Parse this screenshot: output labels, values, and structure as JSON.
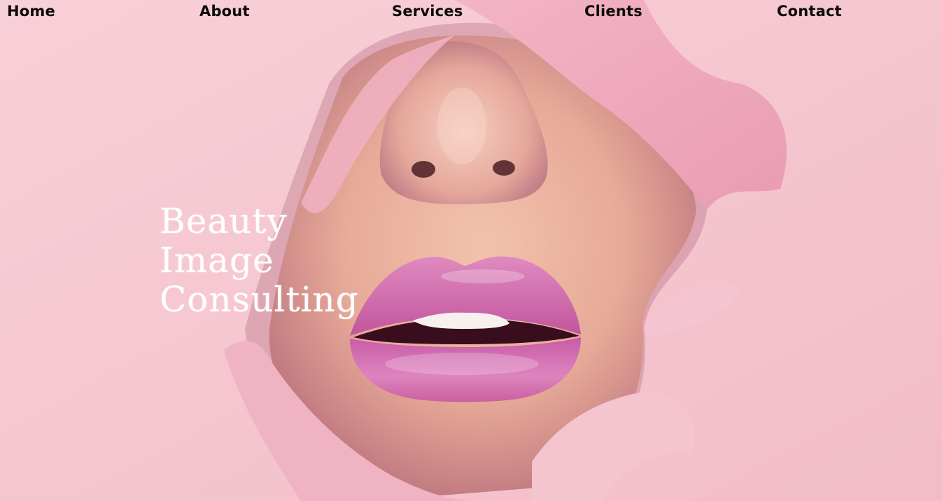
{
  "nav": {
    "items": [
      {
        "label": "Home"
      },
      {
        "label": "About"
      },
      {
        "label": "Services"
      },
      {
        "label": "Clients"
      },
      {
        "label": "Contact"
      }
    ]
  },
  "hero": {
    "title_lines": [
      "Beauty",
      "Image",
      "Consulting"
    ]
  },
  "colors": {
    "background": "#f6c8d0",
    "lip": "#d874b4",
    "nav_text": "#0a0a0a",
    "title_text": "#ffffff"
  }
}
